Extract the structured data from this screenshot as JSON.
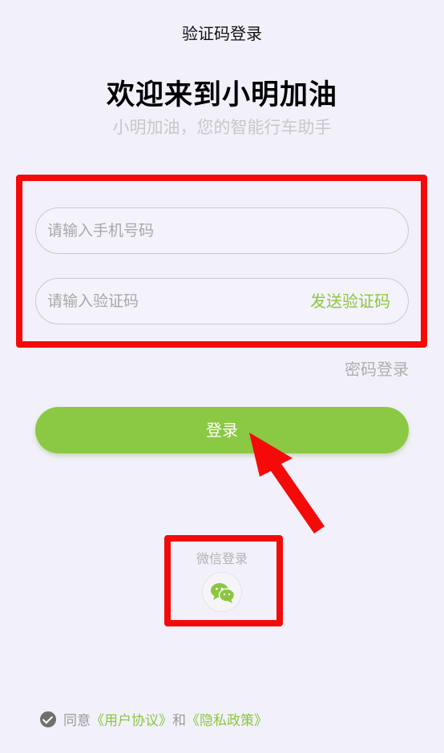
{
  "nav": {
    "title": "验证码登录"
  },
  "welcome": {
    "title": "欢迎来到小明加油",
    "subtitle": "小明加油，您的智能行车助手"
  },
  "form": {
    "phone_placeholder": "请输入手机号码",
    "code_placeholder": "请输入验证码",
    "send_code_label": "发送验证码"
  },
  "password_login_label": "密码登录",
  "login_button_label": "登录",
  "wechat": {
    "label": "微信登录",
    "icon": "wechat-icon"
  },
  "agreement": {
    "prefix": "同意",
    "user_agreement": "《用户协议》",
    "and": "和",
    "privacy_policy": "《隐私政策》"
  },
  "colors": {
    "accent": "#8bc843",
    "annotation": "#f50a0a",
    "background": "#f2f1fb"
  }
}
